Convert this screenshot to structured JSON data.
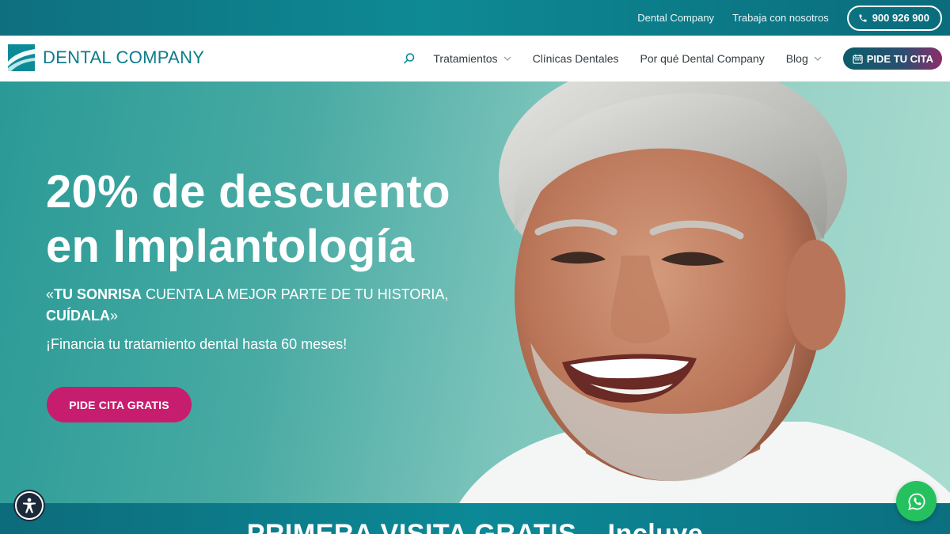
{
  "topbar": {
    "link1": "Dental Company",
    "link2": "Trabaja con nosotros",
    "phone": "900 926 900"
  },
  "logo": {
    "text": "DENTAL COMPANY"
  },
  "nav": {
    "items": [
      {
        "label": "Tratamientos",
        "has_dropdown": true
      },
      {
        "label": "Clínicas Dentales",
        "has_dropdown": false
      },
      {
        "label": "Por qué Dental Company",
        "has_dropdown": false
      },
      {
        "label": "Blog",
        "has_dropdown": true
      }
    ],
    "cta": "PIDE TU CITA"
  },
  "hero": {
    "title_line1": "20% de descuento",
    "title_line2": "en Implantología",
    "quote_open": "«",
    "quote_bold1": "TU SONRISA",
    "quote_normal": " CUENTA LA MEJOR PARTE DE TU HISTORIA,",
    "quote_bold2": "CUÍDALA",
    "quote_close": "»",
    "finance": "¡Financia tu tratamiento dental hasta 60 meses!",
    "cta": "PIDE CITA GRATIS"
  },
  "band": {
    "text": "PRIMERA VISITA GRATIS – Incluye"
  },
  "icons": {
    "search": "search-icon",
    "phone": "phone-icon",
    "calendar": "calendar-icon",
    "accessibility": "accessibility-icon",
    "whatsapp": "whatsapp-icon"
  },
  "colors": {
    "brand_teal": "#0c7c8b",
    "cta_pink": "#c71d6f",
    "whatsapp_green": "#25c15f"
  }
}
